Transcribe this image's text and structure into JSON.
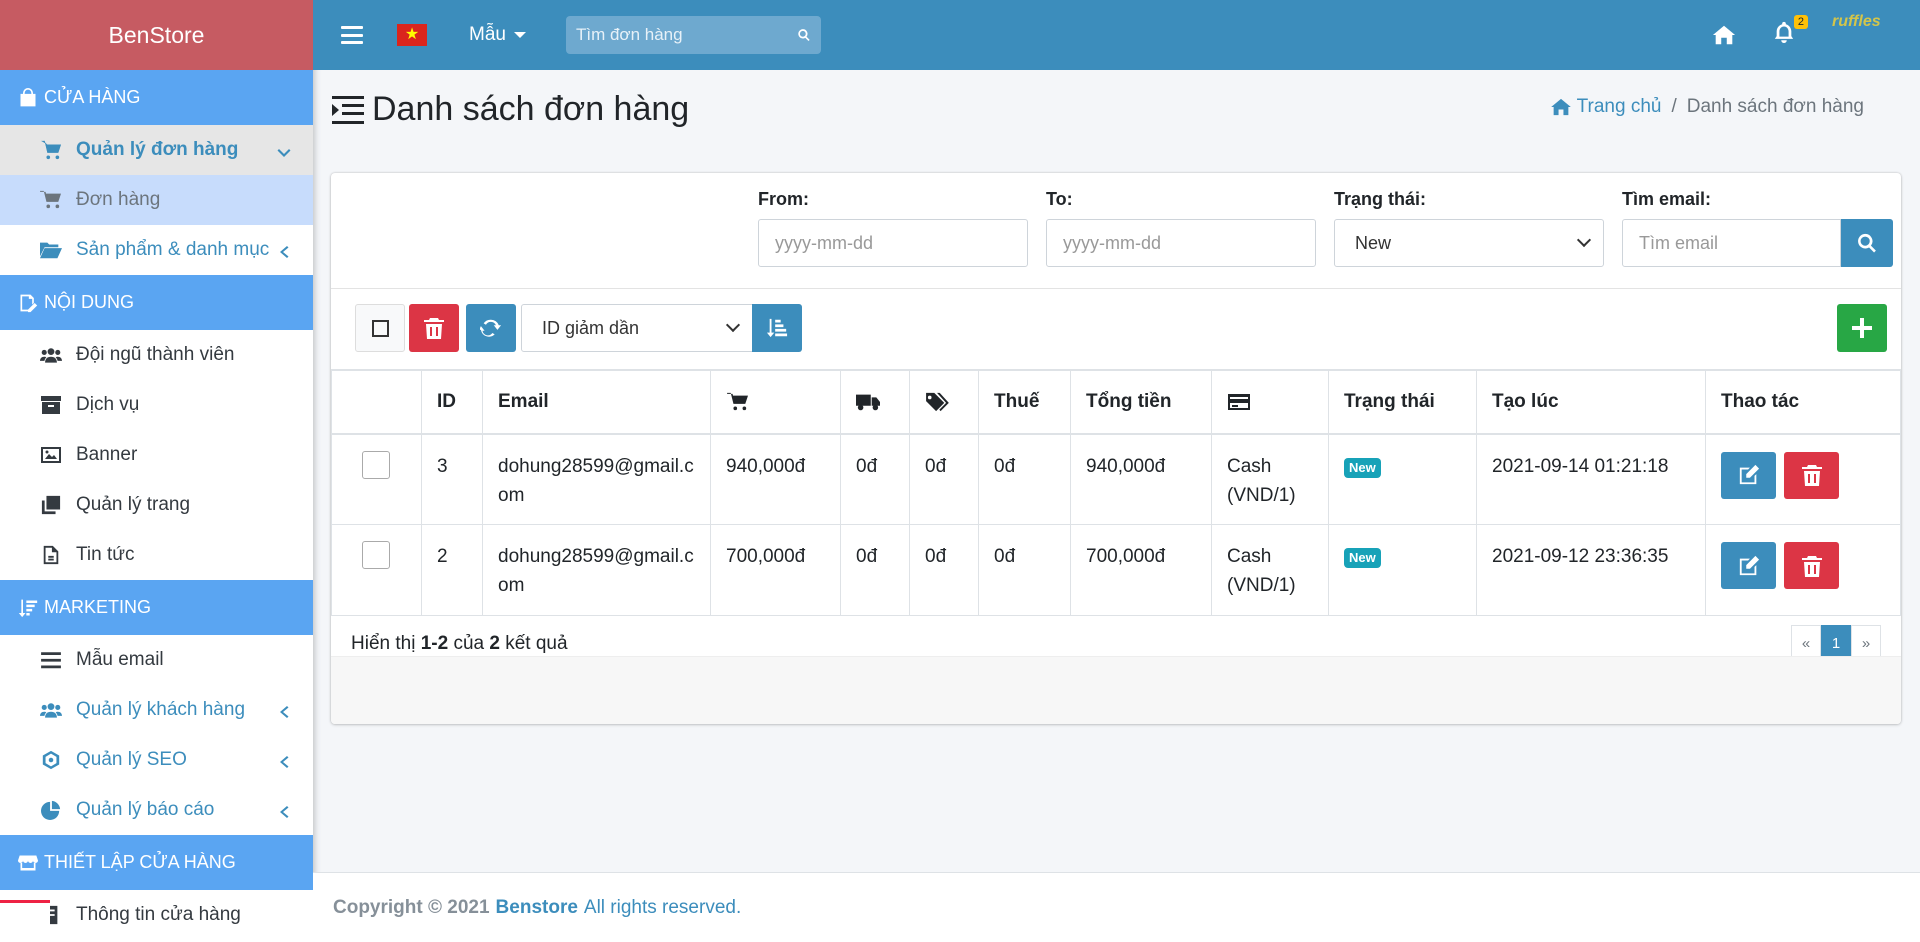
{
  "brand": "BenStore",
  "sidebar": {
    "sections": [
      {
        "title": "CỬA HÀNG"
      },
      {
        "title": "NỘI DUNG"
      },
      {
        "title": "MARKETING"
      },
      {
        "title": "THIẾT LẬP CỬA HÀNG"
      }
    ],
    "items": [
      {
        "label": "Quản lý đơn hàng",
        "icon": "cart-plus-icon"
      },
      {
        "label": "Đơn hàng",
        "icon": "cart-icon"
      },
      {
        "label": "Sản phẩm & danh mục",
        "icon": "folder-open-icon"
      },
      {
        "label": "Đội ngũ thành viên",
        "icon": "users-icon"
      },
      {
        "label": "Dịch vụ",
        "icon": "archive-icon"
      },
      {
        "label": "Banner",
        "icon": "image-icon"
      },
      {
        "label": "Quản lý trang",
        "icon": "copy-icon"
      },
      {
        "label": "Tin tức",
        "icon": "file-icon"
      },
      {
        "label": "Mẫu email",
        "icon": "bars-icon"
      },
      {
        "label": "Quản lý khách hàng",
        "icon": "users-icon"
      },
      {
        "label": "Quản lý SEO",
        "icon": "seo-icon"
      },
      {
        "label": "Quản lý báo cáo",
        "icon": "pie-chart-icon"
      },
      {
        "label": "Thông tin cửa hàng",
        "icon": "info-icon"
      }
    ]
  },
  "topbar": {
    "menu_label": "Mẫu",
    "search_placeholder": "Tìm đơn hàng",
    "notification_count": "2",
    "logo_text": "ruffles"
  },
  "page": {
    "title": "Danh sách đơn hàng",
    "breadcrumb_home": "Trang chủ",
    "breadcrumb_current": "Danh sách đơn hàng"
  },
  "filters": {
    "from_label": "From:",
    "from_placeholder": "yyyy-mm-dd",
    "to_label": "To:",
    "to_placeholder": "yyyy-mm-dd",
    "status_label": "Trạng thái:",
    "status_value": "New",
    "email_label": "Tìm email:",
    "email_placeholder": "Tìm email"
  },
  "toolbar": {
    "sort_value": "ID giảm dần"
  },
  "table": {
    "headers": {
      "id": "ID",
      "email": "Email",
      "tax": "Thuế",
      "total": "Tổng tiền",
      "status": "Trạng thái",
      "created": "Tạo lúc",
      "actions": "Thao tác"
    },
    "rows": [
      {
        "id": "3",
        "email": "dohung28599@gmail.com",
        "subtotal": "940,000đ",
        "shipping": "0đ",
        "discount": "0đ",
        "tax": "0đ",
        "total": "940,000đ",
        "payment": "Cash (VND/1)",
        "status": "New",
        "created": "2021-09-14 01:21:18"
      },
      {
        "id": "2",
        "email": "dohung28599@gmail.com",
        "subtotal": "700,000đ",
        "shipping": "0đ",
        "discount": "0đ",
        "tax": "0đ",
        "total": "700,000đ",
        "payment": "Cash (VND/1)",
        "status": "New",
        "created": "2021-09-12 23:36:35"
      }
    ]
  },
  "summary": {
    "prefix": "Hiển thị",
    "range": "1-2",
    "of": "của",
    "count": "2",
    "suffix": "kết quả"
  },
  "pagination": {
    "prev": "«",
    "current": "1",
    "next": "»"
  },
  "footer": {
    "copyright": "Copyright © 2021",
    "brand": "Benstore",
    "rights": "All rights reserved."
  },
  "colors": {
    "primary": "#3c8dbc",
    "brand_bg": "#c65b62",
    "section_bg": "#5aa5f2",
    "danger": "#dc3545",
    "success": "#28a745",
    "info": "#17a2b8"
  }
}
